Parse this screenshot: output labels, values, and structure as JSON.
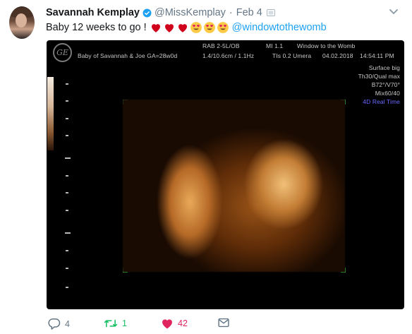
{
  "tweet": {
    "author_name": "Savannah Kemplay",
    "handle": "@MissKemplay",
    "separator": "·",
    "time": "Feb 4",
    "text": "Baby 12 weeks to go !",
    "emojis": [
      "red-heart",
      "red-heart",
      "red-heart",
      "heart-eyes",
      "heart-eyes",
      "heart-eyes"
    ],
    "mention": "@windowtothewomb",
    "accent_color": "#1da1f2"
  },
  "ultrasound": {
    "logo": "GE",
    "probe": "RAB 2-5L/OB",
    "mi": "MI  1.1",
    "clinic": "Window to the Womb",
    "patient": "Baby of Savannah & Joe  GA=28w0d",
    "depth": "1.4/10.6cm / 1.1Hz",
    "tis": "TIs  0.2  Umera",
    "date": "04.02.2018",
    "clock": "14:54:11 PM",
    "settings": [
      "Surface big",
      "Th30/Qual max",
      "B72°/V70°",
      "Mix60/40"
    ],
    "mode": "4D Real Time"
  },
  "actions": {
    "reply_count": "4",
    "retweet_count": "1",
    "like_count": "42",
    "colors": {
      "reply": "#657786",
      "retweet": "#17bf63",
      "like": "#e0245e"
    }
  }
}
